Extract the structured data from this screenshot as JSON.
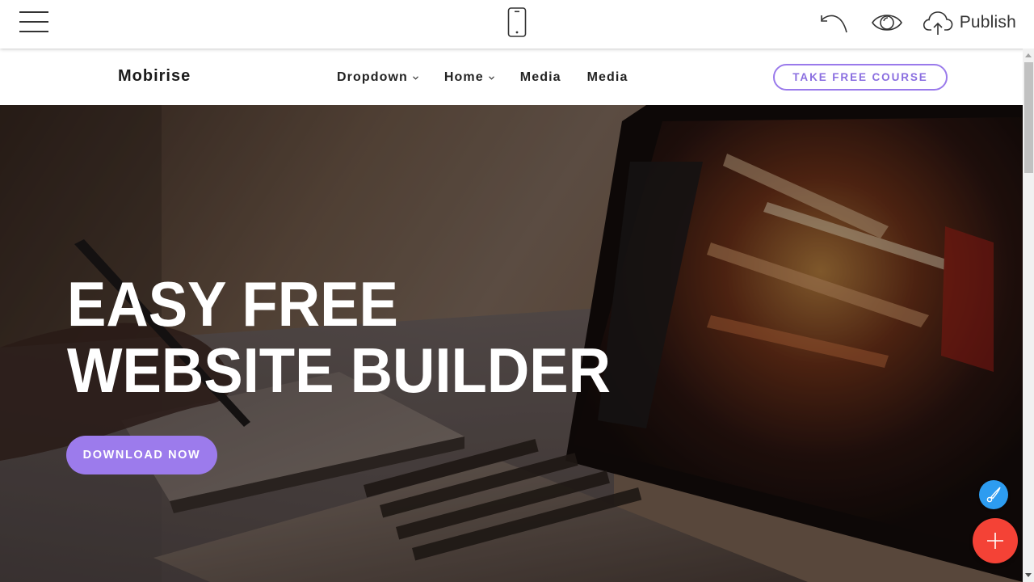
{
  "editor": {
    "toolbar": {
      "menu_icon": "hamburger-menu-icon",
      "device_icon": "mobile-phone-icon",
      "undo_icon": "undo-icon",
      "preview_icon": "eye-icon",
      "publish_icon": "cloud-upload-icon",
      "publish_label": "Publish"
    },
    "fabs": {
      "style_icon": "paintbrush-icon",
      "add_icon": "plus-icon",
      "style_color": "#2d9cf0",
      "add_color": "#f44236"
    }
  },
  "site": {
    "brand": "Mobirise",
    "nav": {
      "items": [
        {
          "label": "Dropdown",
          "has_dropdown": true
        },
        {
          "label": "Home",
          "has_dropdown": true
        },
        {
          "label": "Media",
          "has_dropdown": false
        },
        {
          "label": "Media",
          "has_dropdown": false
        }
      ],
      "cta_label": "TAKE FREE COURSE"
    },
    "hero": {
      "title_line1": "EASY FREE",
      "title_line2": "WEBSITE BUILDER",
      "button_label": "DOWNLOAD NOW",
      "background": "laptop-and-pen-photo",
      "accent_color": "#9c7bec"
    }
  }
}
